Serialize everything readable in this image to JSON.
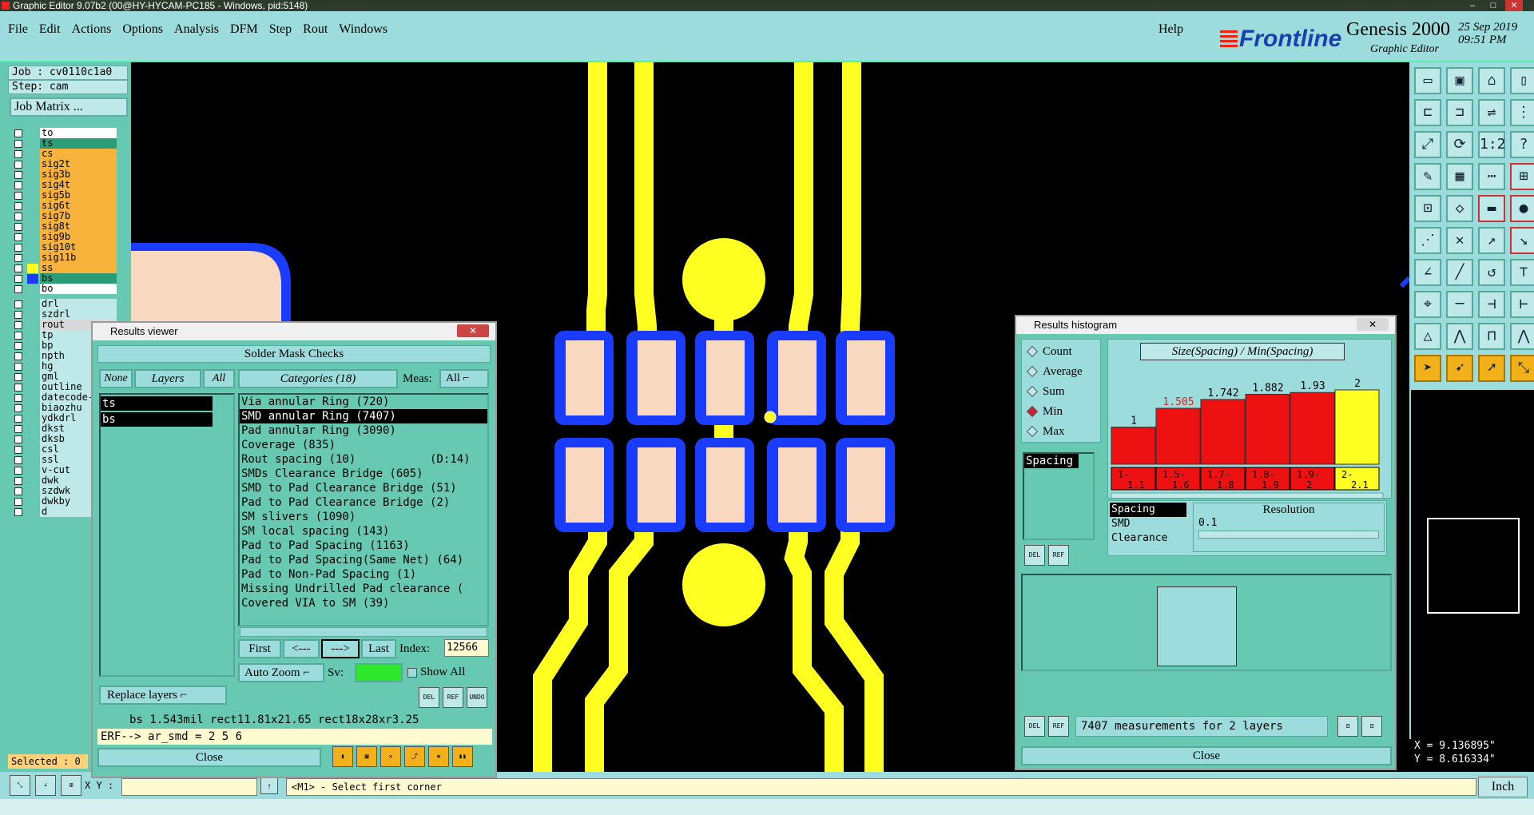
{
  "window": {
    "title": "Graphic Editor 9.07b2 (00@HY-HYCAM-PC185 - Windows, pid:5148)"
  },
  "menu": {
    "items": [
      "File",
      "Edit",
      "Actions",
      "Options",
      "Analysis",
      "DFM",
      "Step",
      "Rout",
      "Windows"
    ],
    "help": "Help"
  },
  "brand": {
    "logo": "Frontline",
    "product": "Genesis 2000",
    "subtitle": "Graphic Editor",
    "date": "25 Sep 2019",
    "time": "09:51 PM"
  },
  "job": {
    "job_label": "Job : cv0110c1a0",
    "step_label": "Step: cam",
    "matrix_button": "Job Matrix ..."
  },
  "layers": [
    {
      "name": "to",
      "color": "#ffffff"
    },
    {
      "name": "ts",
      "color": "#2a9d76"
    },
    {
      "name": "cs",
      "color": "#f7b33c"
    },
    {
      "name": "sig2t",
      "color": "#f7b33c"
    },
    {
      "name": "sig3b",
      "color": "#f7b33c"
    },
    {
      "name": "sig4t",
      "color": "#f7b33c"
    },
    {
      "name": "sig5b",
      "color": "#f7b33c"
    },
    {
      "name": "sig6t",
      "color": "#f7b33c"
    },
    {
      "name": "sig7b",
      "color": "#f7b33c"
    },
    {
      "name": "sig8t",
      "color": "#f7b33c"
    },
    {
      "name": "sig9b",
      "color": "#f7b33c"
    },
    {
      "name": "sig10t",
      "color": "#f7b33c"
    },
    {
      "name": "sig11b",
      "color": "#f7b33c"
    },
    {
      "name": "ss",
      "color": "#f7b33c"
    },
    {
      "name": "bs",
      "color": "#2a9d76"
    },
    {
      "name": "bo",
      "color": "#ffffff"
    },
    {
      "name": "drl",
      "color": "#bfe9e9"
    },
    {
      "name": "szdrl",
      "color": "#bfe9e9"
    },
    {
      "name": "rout",
      "color": "#d8d8d8"
    },
    {
      "name": "tp",
      "color": "#bfe9e9"
    },
    {
      "name": "bp",
      "color": "#bfe9e9"
    },
    {
      "name": "npth",
      "color": "#bfe9e9"
    },
    {
      "name": "hg",
      "color": "#bfe9e9"
    },
    {
      "name": "gml",
      "color": "#bfe9e9"
    },
    {
      "name": "outline",
      "color": "#bfe9e9"
    },
    {
      "name": "datecode-",
      "color": "#bfe9e9"
    },
    {
      "name": "biaozhu",
      "color": "#bfe9e9"
    },
    {
      "name": "ydkdrl",
      "color": "#bfe9e9"
    },
    {
      "name": "dkst",
      "color": "#bfe9e9"
    },
    {
      "name": "dksb",
      "color": "#bfe9e9"
    },
    {
      "name": "csl",
      "color": "#bfe9e9"
    },
    {
      "name": "ssl",
      "color": "#bfe9e9"
    },
    {
      "name": "v-cut",
      "color": "#bfe9e9"
    },
    {
      "name": "dwk",
      "color": "#bfe9e9"
    },
    {
      "name": "szdwk",
      "color": "#bfe9e9"
    },
    {
      "name": "dwkby",
      "color": "#bfe9e9"
    },
    {
      "name": "d",
      "color": "#bfe9e9"
    }
  ],
  "selected": "Selected : 0",
  "results_viewer": {
    "title": "Results viewer",
    "header": "Solder Mask Checks",
    "btn_none": "None",
    "btn_layers": "Layers",
    "btn_all": "All",
    "categories_label": "Categories (18)",
    "meas_label": "Meas:",
    "meas_value": "All",
    "layer_list": [
      "ts",
      "bs"
    ],
    "categories": [
      "Via annular Ring (720)",
      "SMD annular Ring (7407)",
      "Pad annular Ring (3090)",
      "Coverage (835)",
      "Rout spacing (10)           (D:14)",
      "SMDs Clearance Bridge (605)",
      "SMD to Pad Clearance Bridge (51)",
      "Pad to Pad Clearance Bridge (2)",
      "SM slivers (1090)",
      "SM local spacing (143)",
      "Pad to Pad Spacing (1163)",
      "Pad to Pad Spacing(Same Net) (64)",
      "Pad to Non-Pad Spacing (1)",
      "Missing Undrilled Pad clearance (",
      "Covered VIA to SM (39)"
    ],
    "nav": {
      "first": "First",
      "prev": "<---",
      "next": "--->",
      "last": "Last",
      "index_label": "Index:",
      "index_value": "12566"
    },
    "auto_zoom": "Auto Zoom",
    "sv_label": "Sv:",
    "show_all": "Show All",
    "replace_layers": "Replace layers",
    "status": "bs 1.543mil  rect11.81x21.65  rect18x28xr3.25",
    "erf": "ERF--> ar_smd = 2 5 6",
    "close": "Close",
    "small_buttons": [
      "DEL",
      "REF",
      "UNDO"
    ]
  },
  "histogram": {
    "title": "Results histogram",
    "modes": [
      "Count",
      "Average",
      "Sum",
      "Min",
      "Max"
    ],
    "selected_mode": "Min",
    "chart_title": "Size(Spacing) / Min(Spacing)",
    "list": [
      "Spacing"
    ],
    "resolution_label": "Resolution",
    "resolution_value": "0.1",
    "categories": [
      "Spacing",
      "SMD",
      "Clearance"
    ],
    "summary": "7407 measurements for 2 layers",
    "close": "Close",
    "small_buttons": [
      "DEL",
      "REF"
    ]
  },
  "chart_data": {
    "type": "bar",
    "title": "Size(Spacing) / Min(Spacing)",
    "categories": [
      "1-1.1",
      "1.5-1.6",
      "1.7-1.8",
      "1.8-1.9",
      "1.9-2",
      "2-2.1"
    ],
    "bin_labels": [
      [
        "1-",
        "1.1"
      ],
      [
        "1.5-",
        "1.6"
      ],
      [
        "1.7-",
        "1.8"
      ],
      [
        "1.8-",
        "1.9"
      ],
      [
        "1.9-",
        "2"
      ],
      [
        "2-",
        "2.1"
      ]
    ],
    "values": [
      1,
      1.505,
      1.742,
      1.882,
      1.93,
      2
    ],
    "value_labels": [
      "1",
      "1.505",
      "1.742",
      "1.882",
      "1.93",
      "2"
    ],
    "colors": [
      "#ee1111",
      "#ee1111",
      "#ee1111",
      "#ee1111",
      "#ee1111",
      "#ffff22"
    ],
    "label_colors": [
      "#000",
      "#d22",
      "#000",
      "#000",
      "#000",
      "#000"
    ],
    "ylim": [
      0,
      2.15
    ]
  },
  "bottom": {
    "xy_label": "X Y :",
    "prompt": "<M1> - Select first corner",
    "units": "Inch"
  },
  "coordinates": {
    "x": "X = 9.136895\"",
    "y": "Y = 8.616334\""
  }
}
